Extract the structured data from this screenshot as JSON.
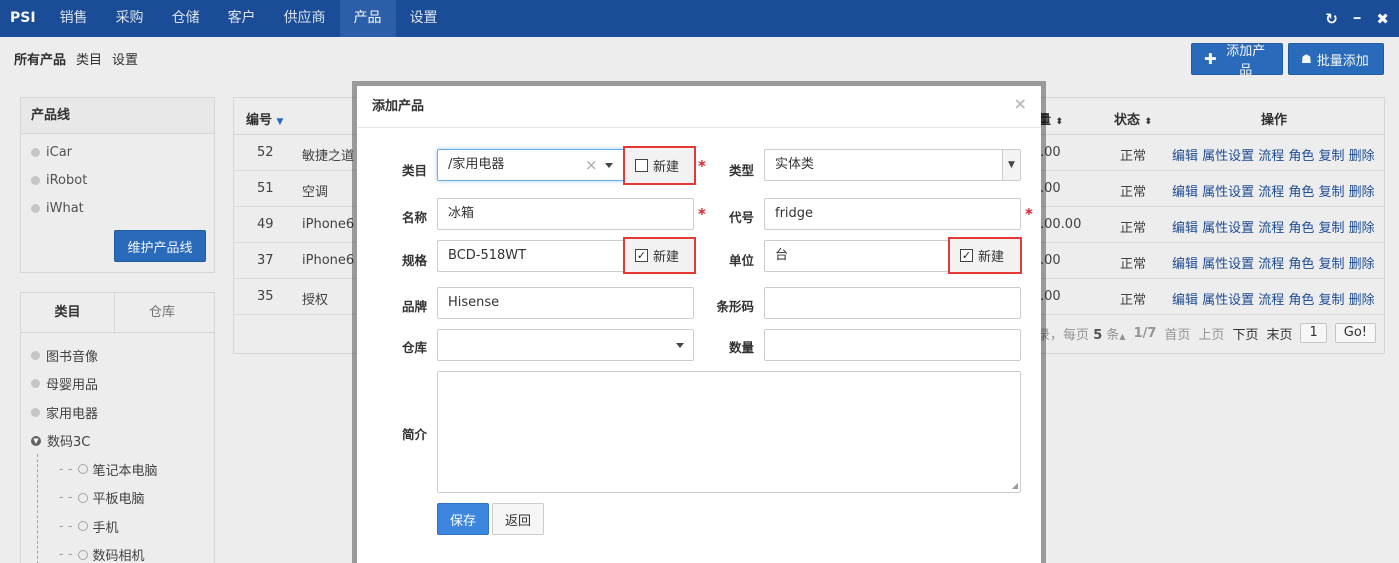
{
  "topnav": {
    "brand": "PSI",
    "items": [
      "销售",
      "采购",
      "仓储",
      "客户",
      "供应商",
      "产品",
      "设置"
    ],
    "active_index": 5,
    "refresh_icon": "↻",
    "minimize_icon": "━",
    "close_icon": "✖"
  },
  "subnav": {
    "items": [
      "所有产品",
      "类目",
      "设置"
    ],
    "add_product": "添加产品",
    "batch_add": "批量添加"
  },
  "product_lines": {
    "title": "产品线",
    "items": [
      "iCar",
      "iRobot",
      "iWhat"
    ],
    "maintain_button": "维护产品线"
  },
  "category_panel": {
    "tabs": [
      "类目",
      "仓库"
    ],
    "items": [
      "图书音像",
      "母婴用品",
      "家用电器",
      "数码3C"
    ],
    "sub_items": [
      "笔记本电脑",
      "平板电脑",
      "手机",
      "数码相机"
    ]
  },
  "table": {
    "col_id": "编号",
    "col_qty_fragment": "量",
    "col_status": "状态",
    "col_ops": "操作",
    "rows": [
      {
        "id": "52",
        "name": "敏捷之道",
        "qty": ".00",
        "status": "正常"
      },
      {
        "id": "51",
        "name": "空调",
        "qty": ".00",
        "status": "正常"
      },
      {
        "id": "49",
        "name": "iPhone6",
        "qty": ".00.00",
        "status": "正常"
      },
      {
        "id": "37",
        "name": "iPhone6",
        "qty": ".00",
        "status": "正常"
      },
      {
        "id": "35",
        "name": "授权",
        "qty": ".00",
        "status": "正常"
      }
    ],
    "ops": "编辑 属性设置 流程 角色 复制 删除",
    "pager": {
      "summary_prefix": "录，每页",
      "per_page": "5",
      "summary_suffix": "条",
      "page_info": "1/7",
      "first": "首页",
      "prev": "上页",
      "next": "下页",
      "last": "末页",
      "page_input": "1",
      "go": "Go!"
    }
  },
  "modal": {
    "title": "添加产品",
    "close": "×",
    "category_label": "类目",
    "category_value": "/家用电器",
    "new_label": "新建",
    "type_label": "类型",
    "type_value": "实体类",
    "name_label": "名称",
    "name_value": "冰箱",
    "code_label": "代号",
    "code_value": "fridge",
    "spec_label": "规格",
    "spec_value": "BCD-518WT",
    "unit_label": "单位",
    "unit_value": "台",
    "brand_label": "品牌",
    "brand_value": "Hisense",
    "barcode_label": "条形码",
    "barcode_value": "",
    "warehouse_label": "仓库",
    "warehouse_value": "",
    "quantity_label": "数量",
    "quantity_value": "",
    "intro_label": "简介",
    "required_mark": "*",
    "save": "保存",
    "back": "返回",
    "check_mark": "✓"
  }
}
